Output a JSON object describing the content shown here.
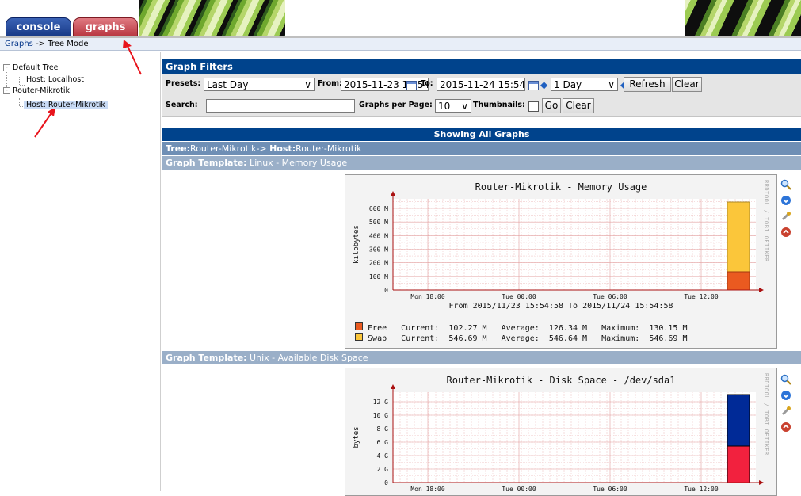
{
  "tabs": {
    "console": "console",
    "graphs": "graphs"
  },
  "breadcrumb": {
    "link": "Graphs",
    "rest": " -> Tree Mode"
  },
  "tree": {
    "default_tree": "Default Tree",
    "host_localhost": "Host: Localhost",
    "router_tree": "Router-Mikrotik",
    "host_router": "Host: Router-Mikrotik"
  },
  "filters": {
    "title": "Graph Filters",
    "presets_label": "Presets:",
    "presets_value": "Last Day",
    "from_label": "From:",
    "from_value": "2015-11-23 15:54",
    "to_label": "To:",
    "to_value": "2015-11-24 15:54",
    "span_value": "1 Day",
    "refresh": "Refresh",
    "clear": "Clear",
    "search_label": "Search:",
    "search_value": "",
    "per_page_label": "Graphs per Page:",
    "per_page_value": "10",
    "thumbnails_label": "Thumbnails:",
    "go": "Go",
    "clear2": "Clear"
  },
  "showing": "Showing All Graphs",
  "tree_header": {
    "tree_label": "Tree:",
    "tree_value": "Router-Mikrotik",
    "sep": "-> ",
    "host_label": "Host:",
    "host_value": "Router-Mikrotik"
  },
  "templates": [
    {
      "label": "Graph Template:",
      "name": " Linux - Memory Usage"
    },
    {
      "label": "Graph Template:",
      "name": " Unix - Available Disk Space"
    }
  ],
  "graph1": {
    "title": "Router-Mikrotik - Memory Usage",
    "ylabel": "kilobytes",
    "yticks": [
      "0",
      "100 M",
      "200 M",
      "300 M",
      "400 M",
      "500 M",
      "600 M"
    ],
    "xticks": [
      "Mon 18:00",
      "Tue 00:00",
      "Tue 06:00",
      "Tue 12:00"
    ],
    "range": "From 2015/11/23 15:54:58 To 2015/11/24 15:54:58",
    "legend": [
      {
        "name": "Free",
        "color": "#ea5a20",
        "current": "102.27 M",
        "average": "126.34 M",
        "maximum": "130.15 M"
      },
      {
        "name": "Swap",
        "color": "#fbc63a",
        "current": "546.69 M",
        "average": "546.64 M",
        "maximum": "546.69 M"
      }
    ],
    "rrd": "RRDTOOL / TOBI OETIKER"
  },
  "graph2": {
    "title": "Router-Mikrotik - Disk Space - /dev/sda1",
    "ylabel": "bytes",
    "yticks": [
      "0",
      "2 G",
      "4 G",
      "6 G",
      "8 G",
      "10 G",
      "12 G"
    ],
    "xticks": [
      "Mon 18:00",
      "Tue 00:00",
      "Tue 06:00",
      "Tue 12:00"
    ],
    "colors": {
      "used": "#f2213e",
      "free": "#002a97"
    },
    "rrd": "RRDTOOL / TOBI OETIKER"
  },
  "icons": [
    "zoom-icon",
    "down-icon",
    "wrench-icon",
    "up-icon"
  ],
  "colors": {
    "header": "#00438c",
    "tree_header": "#6f8fb5",
    "template_header": "#9aafc8"
  }
}
